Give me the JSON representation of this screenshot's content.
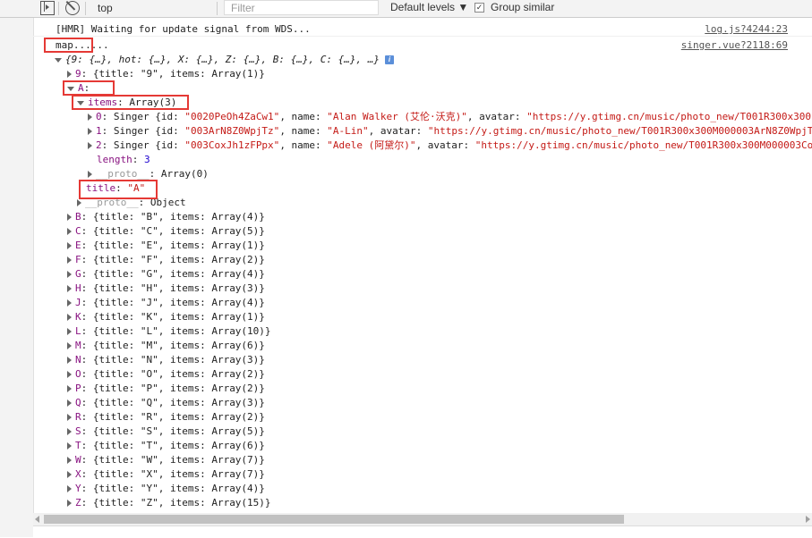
{
  "toolbar": {
    "context": "top",
    "filter_placeholder": "Filter",
    "levels_label": "Default levels ▼",
    "group_similar_label": "Group similar",
    "group_similar_checked": "✓"
  },
  "log1": {
    "text": "[HMR] Waiting for update signal from WDS...",
    "source": "log.js?4244:23"
  },
  "log2": {
    "text": "map......",
    "source": "singer.vue?2118:69"
  },
  "root_summary": "{9: {…}, hot: {…}, X: {…}, Z: {…}, B: {…}, C: {…}, …}",
  "row9": {
    "key": "9",
    "rest": ": {title: \"9\", items: Array(1)}"
  },
  "rowA": {
    "key": "A",
    "colon": ":"
  },
  "items_row": {
    "key": "items",
    "rest": ": Array(3)"
  },
  "singers": [
    {
      "idx": "0",
      "text": ": Singer {id: ",
      "id": "\"0020PeOh4ZaCw1\"",
      "mid": ", name: ",
      "name": "\"Alan Walker (艾伦·沃克)\"",
      "tail": ", avatar: ",
      "avatar": "\"https://y.gtimg.cn/music/photo_new/T001R300x300"
    },
    {
      "idx": "1",
      "text": ": Singer {id: ",
      "id": "\"003ArN8Z0WpjTz\"",
      "mid": ", name: ",
      "name": "\"A-Lin\"",
      "tail": ", avatar: ",
      "avatar": "\"https://y.gtimg.cn/music/photo_new/T001R300x300M000003ArN8Z0WpjT"
    },
    {
      "idx": "2",
      "text": ": Singer {id: ",
      "id": "\"003CoxJh1zFPpx\"",
      "mid": ", name: ",
      "name": "\"Adele (阿黛尔)\"",
      "tail": ", avatar: ",
      "avatar": "\"https://y.gtimg.cn/music/photo_new/T001R300x300M000003Co"
    }
  ],
  "length_row": {
    "key": "length",
    "value": "3"
  },
  "proto_array": {
    "key": "__proto__",
    "value": ": Array(0)"
  },
  "title_row": {
    "key": "title",
    "value": "\"A\""
  },
  "proto_object": {
    "key": "__proto__",
    "value": ": Object"
  },
  "groups": [
    {
      "key": "B",
      "rest": ": {title: \"B\", items: Array(4)}"
    },
    {
      "key": "C",
      "rest": ": {title: \"C\", items: Array(5)}"
    },
    {
      "key": "E",
      "rest": ": {title: \"E\", items: Array(1)}"
    },
    {
      "key": "F",
      "rest": ": {title: \"F\", items: Array(2)}"
    },
    {
      "key": "G",
      "rest": ": {title: \"G\", items: Array(4)}"
    },
    {
      "key": "H",
      "rest": ": {title: \"H\", items: Array(3)}"
    },
    {
      "key": "J",
      "rest": ": {title: \"J\", items: Array(4)}"
    },
    {
      "key": "K",
      "rest": ": {title: \"K\", items: Array(1)}"
    },
    {
      "key": "L",
      "rest": ": {title: \"L\", items: Array(10)}"
    },
    {
      "key": "M",
      "rest": ": {title: \"M\", items: Array(6)}"
    },
    {
      "key": "N",
      "rest": ": {title: \"N\", items: Array(3)}"
    },
    {
      "key": "O",
      "rest": ": {title: \"O\", items: Array(2)}"
    },
    {
      "key": "P",
      "rest": ": {title: \"P\", items: Array(2)}"
    },
    {
      "key": "Q",
      "rest": ": {title: \"Q\", items: Array(3)}"
    },
    {
      "key": "R",
      "rest": ": {title: \"R\", items: Array(2)}"
    },
    {
      "key": "S",
      "rest": ": {title: \"S\", items: Array(5)}"
    },
    {
      "key": "T",
      "rest": ": {title: \"T\", items: Array(6)}"
    },
    {
      "key": "W",
      "rest": ": {title: \"W\", items: Array(7)}"
    },
    {
      "key": "X",
      "rest": ": {title: \"X\", items: Array(7)}"
    },
    {
      "key": "Y",
      "rest": ": {title: \"Y\", items: Array(4)}"
    },
    {
      "key": "Z",
      "rest": ": {title: \"Z\", items: Array(15)}"
    }
  ],
  "colors": {
    "highlight": "#e53935",
    "key": "#881280",
    "string": "#c41a16",
    "number": "#1c00cf"
  }
}
